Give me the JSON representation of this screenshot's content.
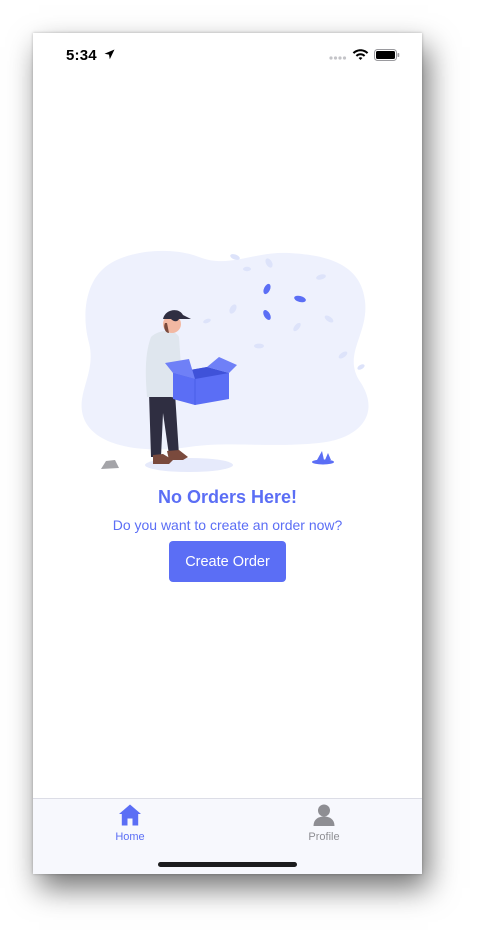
{
  "status_bar": {
    "time": "5:34"
  },
  "empty_state": {
    "title": "No Orders Here!",
    "subtitle": "Do you want to create an order now?",
    "button_label": "Create Order"
  },
  "tab_bar": {
    "tabs": [
      {
        "label": "Home",
        "icon": "home-icon",
        "active": true
      },
      {
        "label": "Profile",
        "icon": "person-icon",
        "active": false
      }
    ]
  },
  "colors": {
    "accent": "#5b6ef5",
    "inactive": "#8e8e93",
    "tab_bar_bg": "#f7f8fd"
  }
}
